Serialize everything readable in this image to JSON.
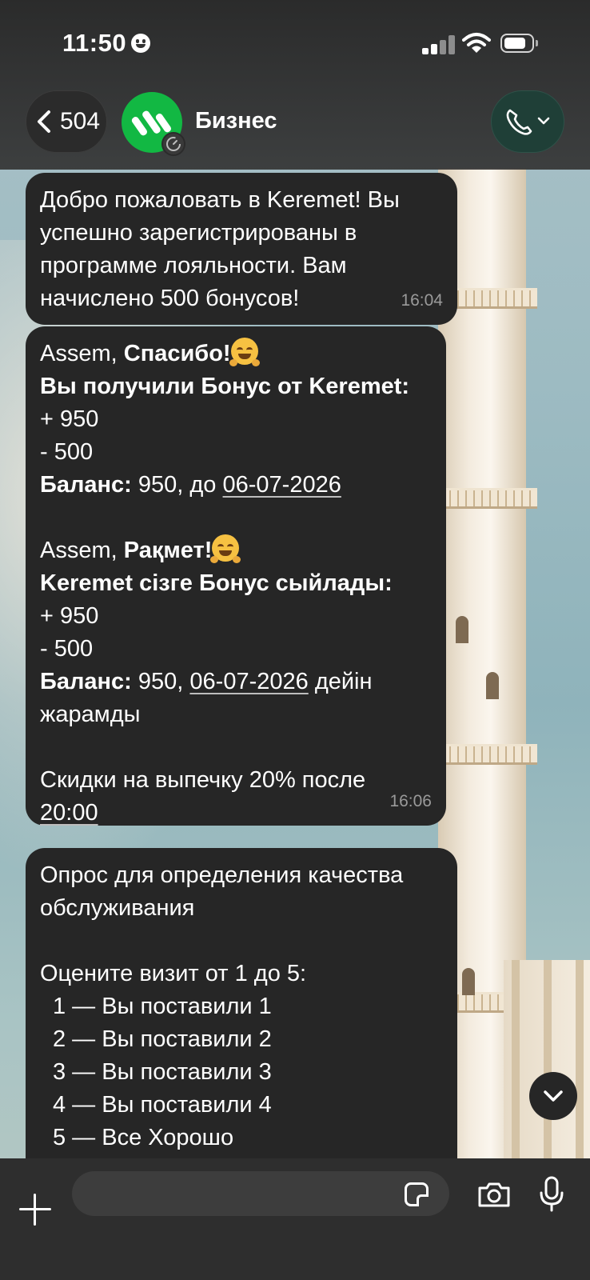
{
  "status_bar": {
    "time": "11:50"
  },
  "header": {
    "back_count": "504",
    "chat_name": "Бизнес",
    "avatar_color": "#12b843"
  },
  "messages": [
    {
      "text": "Добро пожаловать в Keremet! Вы успешно зарегистрированы в программе лояльности. Вам начислено 500 бонусов!",
      "time": "16:04"
    },
    {
      "greeting_name": "Assem,",
      "greeting_ru": "Спасибо!",
      "bonus_title_ru": "Вы получили Бонус от Keremet:",
      "plus_ru": "+ 950",
      "minus_ru": "- 500",
      "balance_label": "Баланс:",
      "balance_ru_pre": "950, до",
      "date": "06-07-2026",
      "greeting_kz": "Рақмет!",
      "bonus_title_kz": "Keremet сізге Бонус сыйлады:",
      "plus_kz": "+ 950",
      "minus_kz": "- 500",
      "balance_kz_pre": "950,",
      "balance_kz_post": "дейін",
      "balance_kz_line2": "жарамды",
      "promo": "Скидки на выпечку 20% после",
      "promo_time": "20:00",
      "time": "16:06"
    },
    {
      "title_line1": "Опрос для определения качества",
      "title_line2": "обслуживания",
      "prompt": "Оцените визит от 1 до 5:",
      "options": [
        "1 — Вы поставили 1",
        "2 — Вы поставили 2",
        "3 — Вы поставили 3",
        "4 — Вы поставили 4",
        "5 — Все Хорошо"
      ]
    }
  ],
  "input": {
    "placeholder": ""
  },
  "colors": {
    "bubble": "#262626",
    "header": "#2f2f2f",
    "call_button": "#1f3f37"
  }
}
